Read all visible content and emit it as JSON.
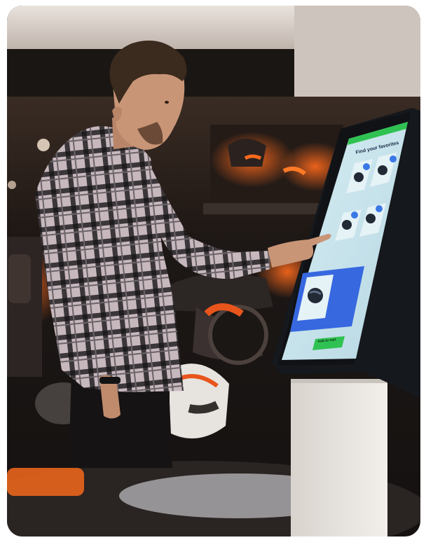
{
  "kiosk": {
    "title": "Find your favorites",
    "cta_label": "Add to cart",
    "accent": "#2fc252",
    "screen_bg": "#cfe6ee",
    "card_blue": "#3768e0"
  },
  "colors": {
    "store_background": "#1d1816",
    "shelf_glow": "#e8551c",
    "kiosk_stand": "#e9e6e2",
    "shirt_plaid_light": "#c9b9be",
    "shirt_plaid_dark": "#2f2c30"
  }
}
